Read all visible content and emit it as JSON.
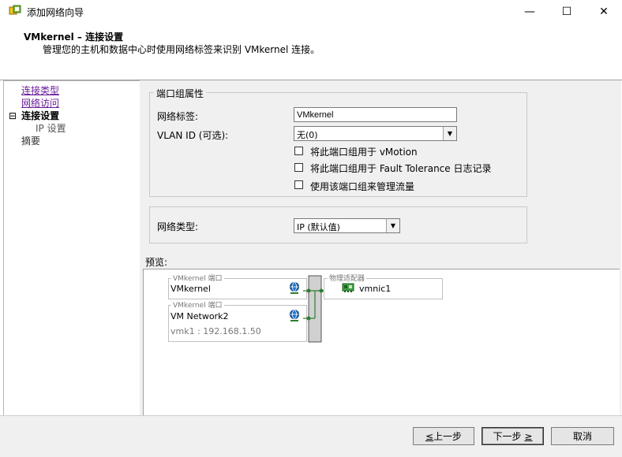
{
  "window": {
    "title": "添加网络向导",
    "minimize": "—",
    "maximize": "☐",
    "close": "✕"
  },
  "header": {
    "title": "VMkernel – 连接设置",
    "subtitle": "管理您的主机和数据中心时使用网络标签来识别 VMkernel 连接。"
  },
  "nav": {
    "items": [
      {
        "label": "连接类型"
      },
      {
        "label": "网络访问"
      },
      {
        "label": "连接设置",
        "expander": "⊟"
      },
      {
        "label": "IP 设置"
      },
      {
        "label": "摘要"
      }
    ]
  },
  "portgroup": {
    "legend": "端口组属性",
    "network_label_caption": "网络标签:",
    "network_label_value": "VMkernel",
    "vlan_caption": "VLAN ID (可选):",
    "vlan_value": "无(0)",
    "checkboxes": [
      {
        "label": "将此端口组用于 vMotion",
        "checked": false
      },
      {
        "label": "将此端口组用于 Fault Tolerance 日志记录",
        "checked": false
      },
      {
        "label": "使用该端口组来管理流量",
        "checked": false
      }
    ]
  },
  "network_type": {
    "caption": "网络类型:",
    "value": "IP (默认值)"
  },
  "preview": {
    "caption": "预览:",
    "groups": [
      {
        "legend": "VMkernel 端口",
        "name": "VMkernel"
      },
      {
        "legend": "VMkernel 端口",
        "name": "VM Network2",
        "detail": "vmk1 : 192.168.1.50"
      }
    ],
    "adapter_legend": "物理适配器",
    "adapter_name": "vmnic1"
  },
  "footer": {
    "back_prefix": "",
    "back_key": "≤",
    "back_label": "上一步",
    "next_label": "下一步",
    "next_key": "≥",
    "cancel_label": "取消"
  },
  "colors": {
    "link": "#6a1b9a",
    "switch_line": "#2e7d32",
    "nic_icon": "#43a047"
  }
}
